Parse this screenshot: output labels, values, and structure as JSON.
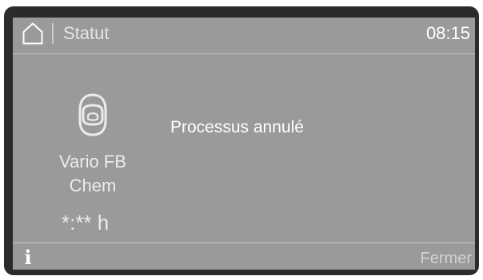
{
  "header": {
    "home_icon": "home-icon",
    "title": "Statut",
    "time": "08:15"
  },
  "program": {
    "icon": "mask-icon",
    "name_line1": "Vario FB",
    "name_line2": "Chem",
    "remaining_time": "*:** h"
  },
  "status": {
    "message": "Processus annulé"
  },
  "footer": {
    "info_icon": "info-icon",
    "close_label": "Fermer"
  },
  "colors": {
    "screen_background": "#9a9a9a",
    "bezel": "#2b2b2b",
    "text": "#ffffff"
  }
}
